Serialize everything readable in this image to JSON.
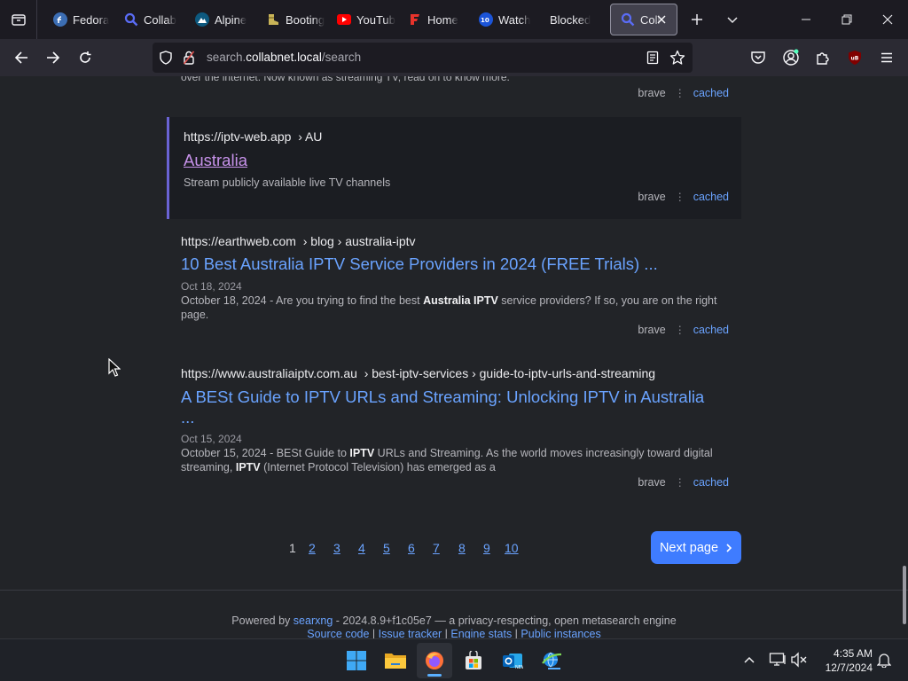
{
  "browser": {
    "tabs": [
      {
        "title": "Fedora",
        "icon": "fedora-icon",
        "active": false
      },
      {
        "title": "Collab",
        "icon": "search-icon",
        "active": false
      },
      {
        "title": "Alpine",
        "icon": "alpine-icon",
        "active": false
      },
      {
        "title": "Booting",
        "icon": "boot-icon",
        "active": false
      },
      {
        "title": "YouTube",
        "icon": "youtube-icon",
        "active": false
      },
      {
        "title": "Home",
        "icon": "home-f-icon",
        "active": false
      },
      {
        "title": "Watch",
        "icon": "watch-icon",
        "active": false
      },
      {
        "title": "Blocked",
        "icon": "",
        "active": false
      },
      {
        "title": "Coll",
        "icon": "search-icon",
        "active": true
      }
    ],
    "url": {
      "prefix": "search.",
      "host": "collabnet.local",
      "path": "/search"
    },
    "accent": "#6aa3ff"
  },
  "page": {
    "top_snippet": "over the internet. Now known as streaming TV, read on to know more.",
    "top_meta": {
      "engine": "brave",
      "cached": "cached"
    },
    "results": [
      {
        "url_host": "https://iptv-web.app",
        "url_path": "› AU",
        "title": "Australia",
        "date": "",
        "desc_parts": [
          {
            "t": "Stream publicly available live TV channels",
            "b": false
          }
        ],
        "engine": "brave",
        "cached": "cached"
      },
      {
        "url_host": "https://earthweb.com",
        "url_path": "› blog › australia-iptv",
        "title": "10 Best Australia IPTV Service Providers in 2024 (FREE Trials) ...",
        "date": "Oct 18, 2024",
        "desc_parts": [
          {
            "t": "October 18, 2024 - Are you trying to find the best ",
            "b": false
          },
          {
            "t": "Australia IPTV",
            "b": true
          },
          {
            "t": " service providers? If so, you are on the right page.",
            "b": false
          }
        ],
        "engine": "brave",
        "cached": "cached"
      },
      {
        "url_host": "https://www.australiaiptv.com.au",
        "url_path": "› best-iptv-services › guide-to-iptv-urls-and-streaming",
        "title": "A BESt Guide to IPTV URLs and Streaming: Unlocking IPTV in Australia",
        "title2": "...",
        "date": "Oct 15, 2024",
        "desc_parts": [
          {
            "t": "October 15, 2024 - BESt Guide to ",
            "b": false
          },
          {
            "t": "IPTV",
            "b": true
          },
          {
            "t": " URLs and Streaming. As the world moves increasingly toward digital streaming, ",
            "b": false
          },
          {
            "t": "IPTV",
            "b": true
          },
          {
            "t": " (Internet Protocol Television) has emerged as a",
            "b": false
          }
        ],
        "engine": "brave",
        "cached": "cached"
      }
    ],
    "pagination": {
      "current": "1",
      "pages": [
        "2",
        "3",
        "4",
        "5",
        "6",
        "7",
        "8",
        "9",
        "10"
      ],
      "next_label": "Next page"
    },
    "footer": {
      "powered_by": "Powered by",
      "engine_name": "searxng",
      "version_text": "- 2024.8.9+f1c05e7 — a privacy-respecting, open metasearch engine",
      "links": [
        "Source code",
        "Issue tracker",
        "Engine stats",
        "Public instances"
      ]
    }
  },
  "taskbar": {
    "apps": [
      "windows-start-icon",
      "file-explorer-icon",
      "firefox-icon",
      "microsoft-store-icon",
      "outlook-icon",
      "network-globe-icon"
    ],
    "time": "4:35 AM",
    "date": "12/7/2024"
  }
}
